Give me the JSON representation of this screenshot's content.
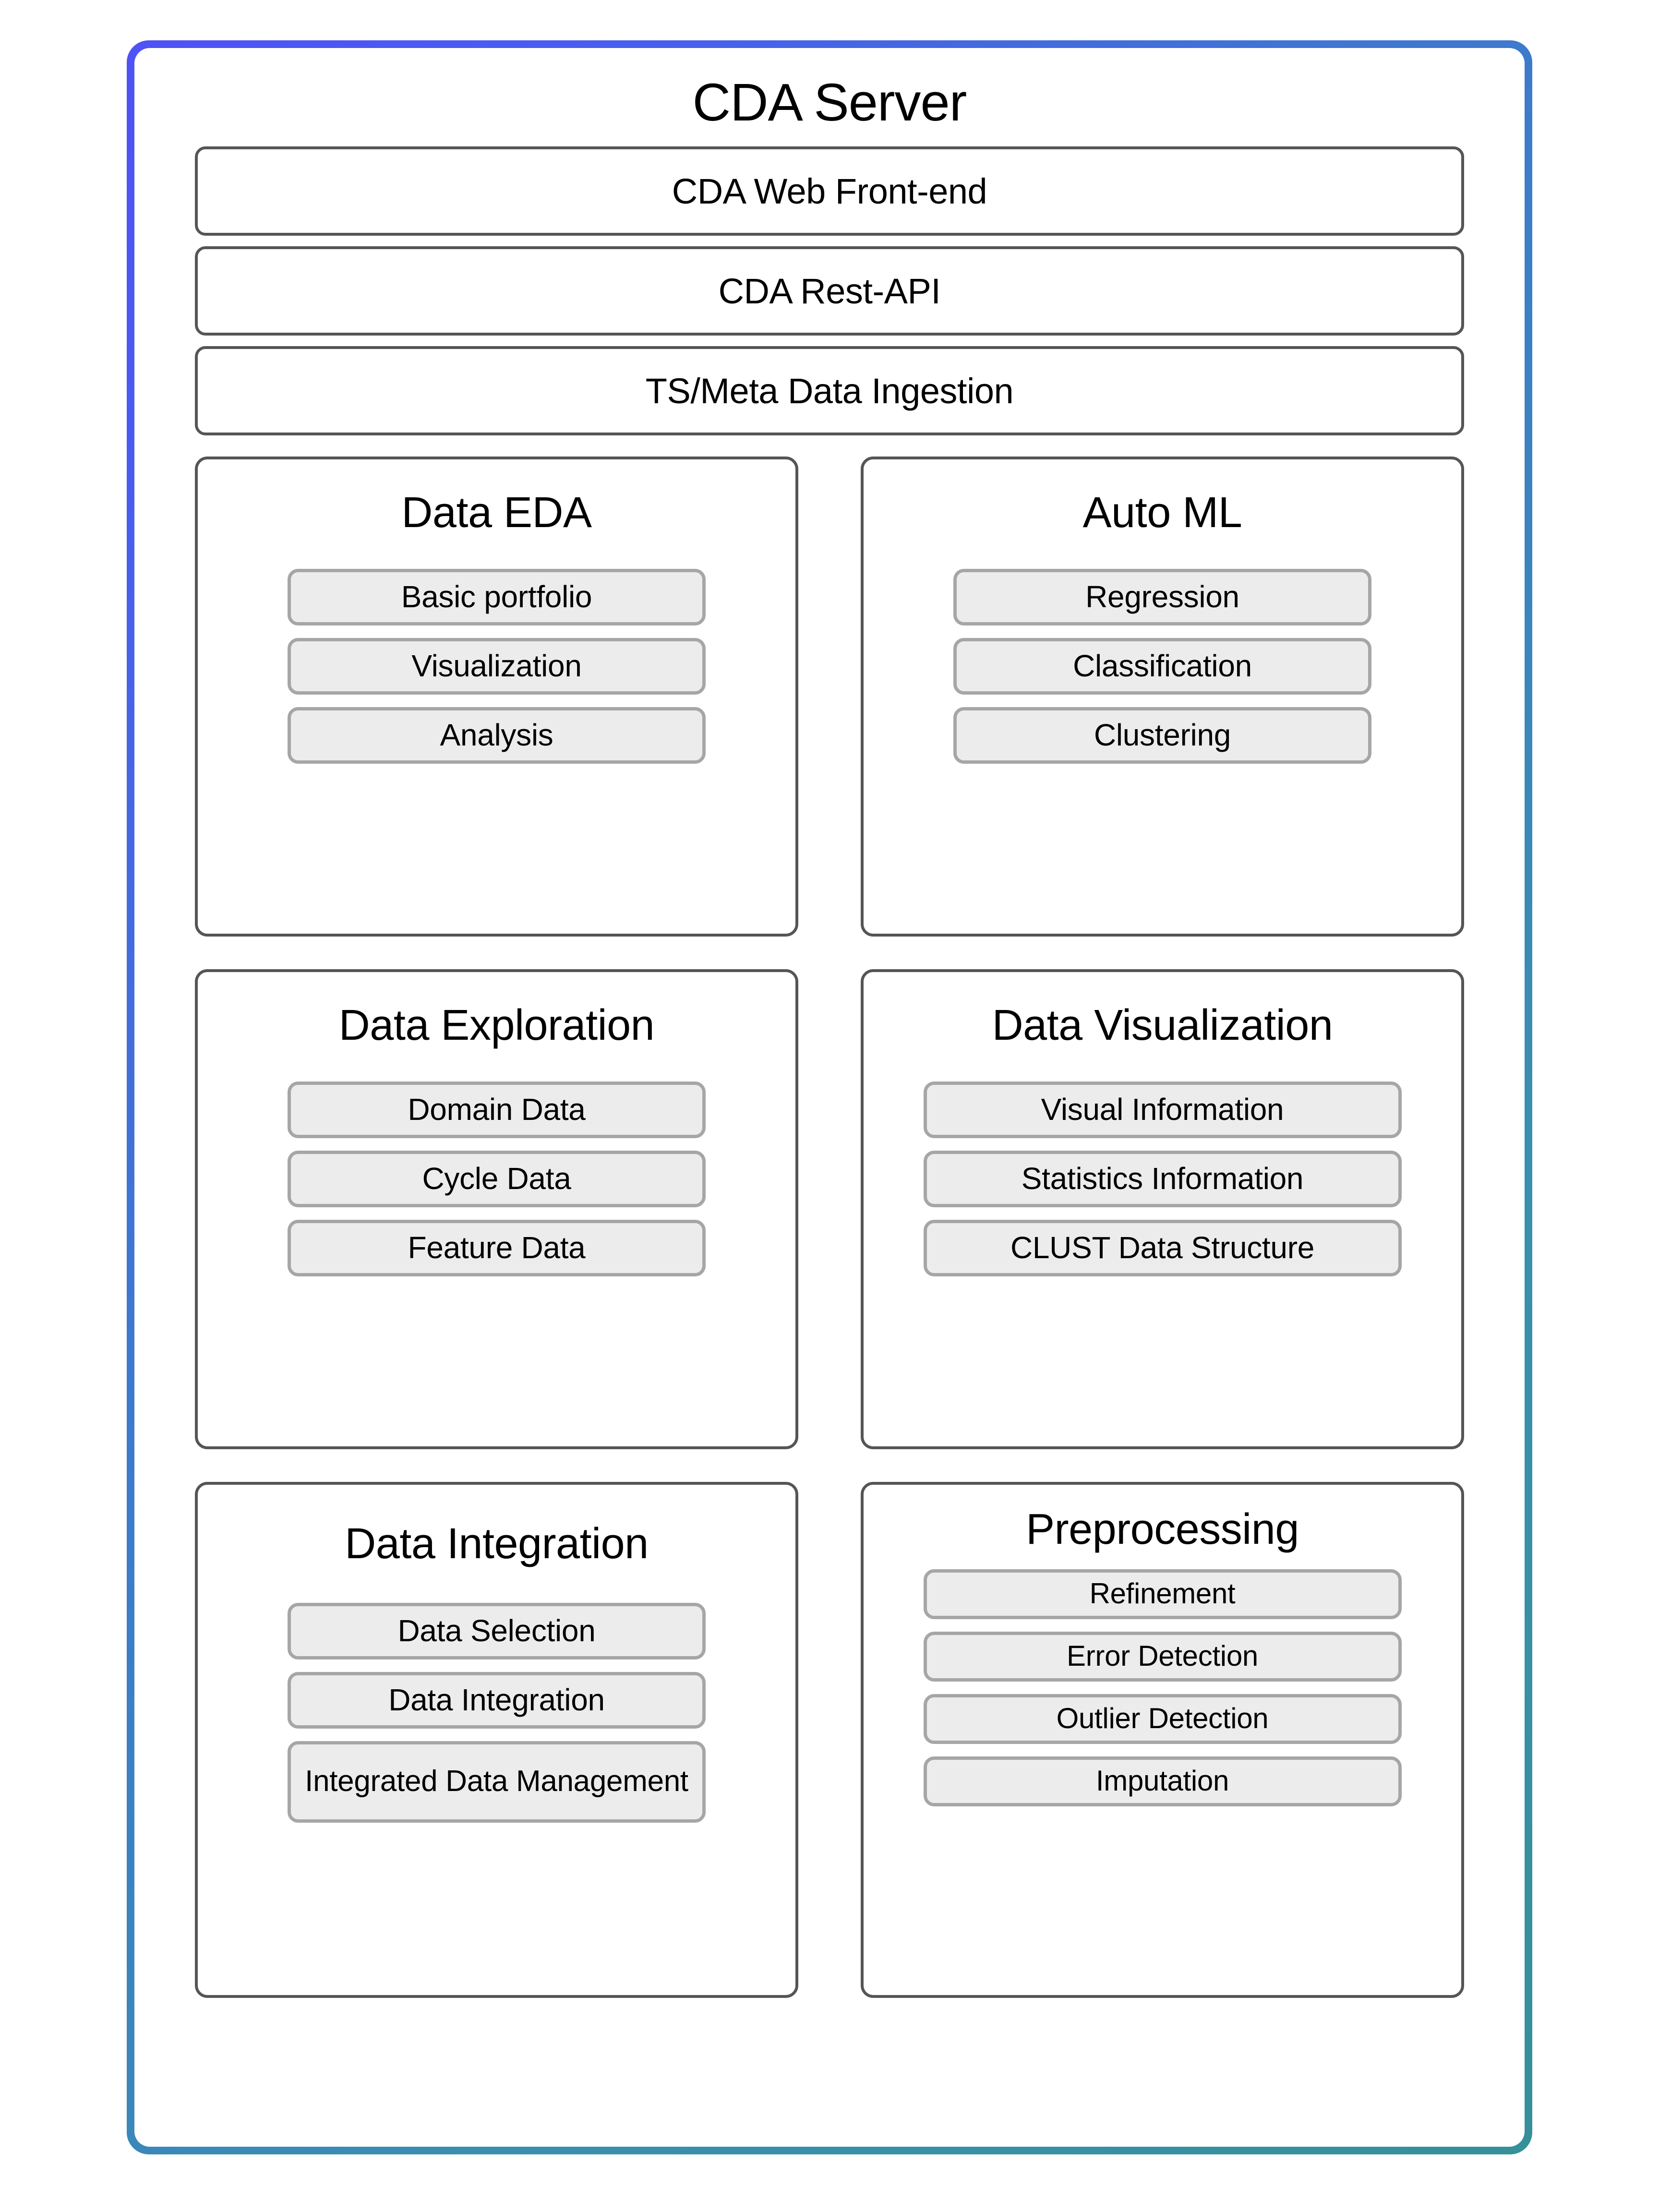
{
  "diagram": {
    "title": "CDA Server",
    "border_gradient": {
      "start": "#4f52f5",
      "mid": "#3b83c0",
      "end": "#35909a"
    },
    "card_border_color": "#555555",
    "chip_fill_color": "#ececec",
    "chip_border_color": "#a6a6a6"
  },
  "layers": [
    {
      "label": "CDA Web Front-end"
    },
    {
      "label": "CDA Rest-API"
    },
    {
      "label": "TS/Meta Data Ingestion"
    }
  ],
  "modules": [
    {
      "title": "Data EDA",
      "items": [
        {
          "label": "Basic portfolio"
        },
        {
          "label": "Visualization"
        },
        {
          "label": "Analysis"
        }
      ]
    },
    {
      "title": "Auto ML",
      "items": [
        {
          "label": "Regression"
        },
        {
          "label": "Classification"
        },
        {
          "label": "Clustering"
        }
      ]
    },
    {
      "title": "Data Exploration",
      "items": [
        {
          "label": "Domain Data"
        },
        {
          "label": "Cycle Data"
        },
        {
          "label": "Feature Data"
        }
      ]
    },
    {
      "title": "Data Visualization",
      "items": [
        {
          "label": "Visual Information"
        },
        {
          "label": "Statistics Information"
        },
        {
          "label": "CLUST Data Structure"
        }
      ]
    },
    {
      "title": "Data Integration",
      "items": [
        {
          "label": "Data Selection"
        },
        {
          "label": "Data Integration"
        },
        {
          "label": "Integrated Data Management"
        }
      ]
    },
    {
      "title": "Preprocessing",
      "items": [
        {
          "label": "Refinement"
        },
        {
          "label": "Error Detection"
        },
        {
          "label": "Outlier Detection"
        },
        {
          "label": "Imputation"
        }
      ]
    }
  ]
}
